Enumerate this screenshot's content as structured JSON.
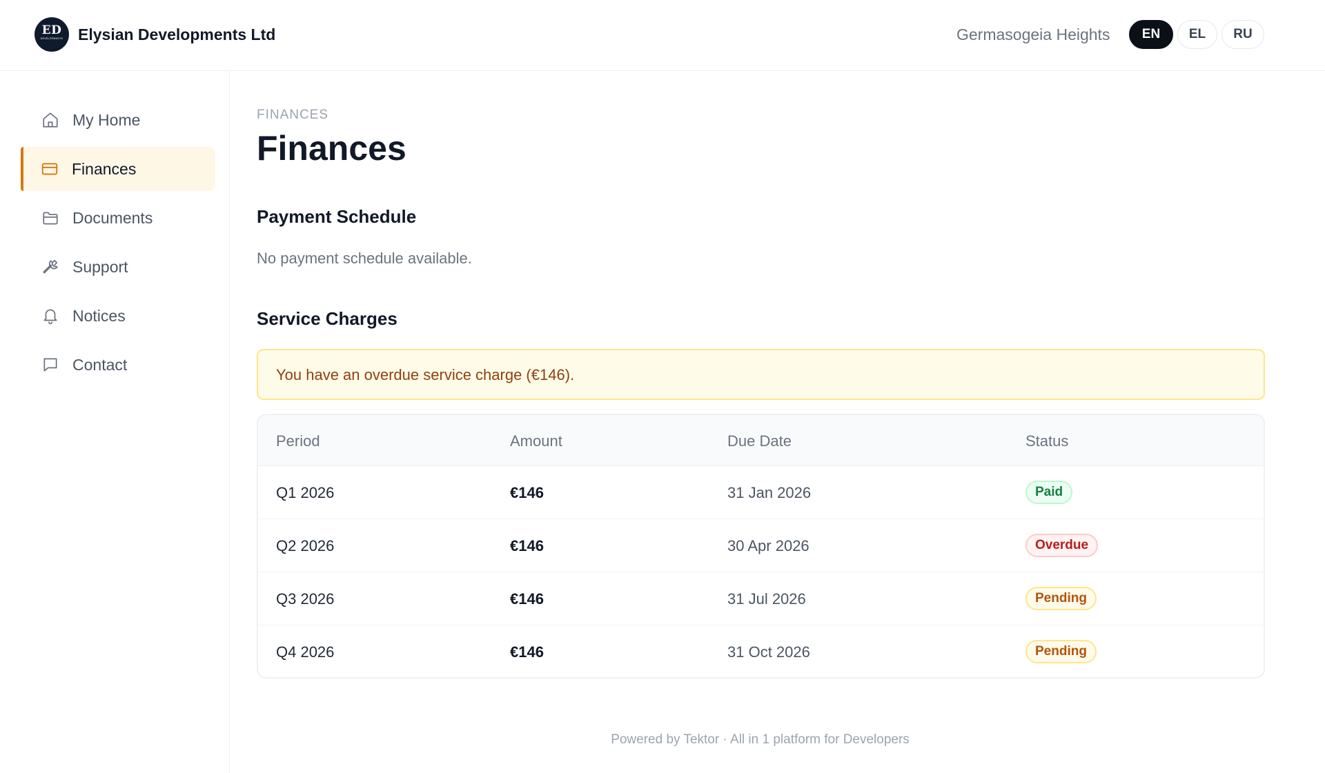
{
  "header": {
    "logo_monogram": "ED",
    "logo_subtext": "DEVELOPMENTS",
    "company_name": "Elysian Developments Ltd",
    "project_name": "Germasogeia Heights",
    "languages": [
      {
        "code": "EN",
        "active": true
      },
      {
        "code": "EL",
        "active": false
      },
      {
        "code": "RU",
        "active": false
      }
    ]
  },
  "sidebar": {
    "items": [
      {
        "label": "My Home",
        "icon": "home-icon"
      },
      {
        "label": "Finances",
        "icon": "credit-card-icon",
        "active": true
      },
      {
        "label": "Documents",
        "icon": "folder-icon"
      },
      {
        "label": "Support",
        "icon": "wrench-icon"
      },
      {
        "label": "Notices",
        "icon": "bell-icon"
      },
      {
        "label": "Contact",
        "icon": "chat-icon"
      }
    ]
  },
  "main": {
    "eyebrow": "FINANCES",
    "title": "Finances",
    "payment_schedule": {
      "heading": "Payment Schedule",
      "empty_text": "No payment schedule available."
    },
    "service_charges": {
      "heading": "Service Charges",
      "alert": "You have an overdue service charge (€146).",
      "columns": [
        "Period",
        "Amount",
        "Due Date",
        "Status"
      ],
      "rows": [
        {
          "period": "Q1 2026",
          "amount": "€146",
          "due_date": "31 Jan 2026",
          "status": "Paid"
        },
        {
          "period": "Q2 2026",
          "amount": "€146",
          "due_date": "30 Apr 2026",
          "status": "Overdue"
        },
        {
          "period": "Q3 2026",
          "amount": "€146",
          "due_date": "31 Jul 2026",
          "status": "Pending"
        },
        {
          "period": "Q4 2026",
          "amount": "€146",
          "due_date": "31 Oct 2026",
          "status": "Pending"
        }
      ]
    }
  },
  "footer": {
    "text": "Powered by Tektor · All in 1 platform for Developers"
  },
  "colors": {
    "accent": "#d97706",
    "active_bg": "#fff7e6",
    "paid": "#15803d",
    "overdue": "#b91c1c",
    "pending": "#b45309"
  }
}
